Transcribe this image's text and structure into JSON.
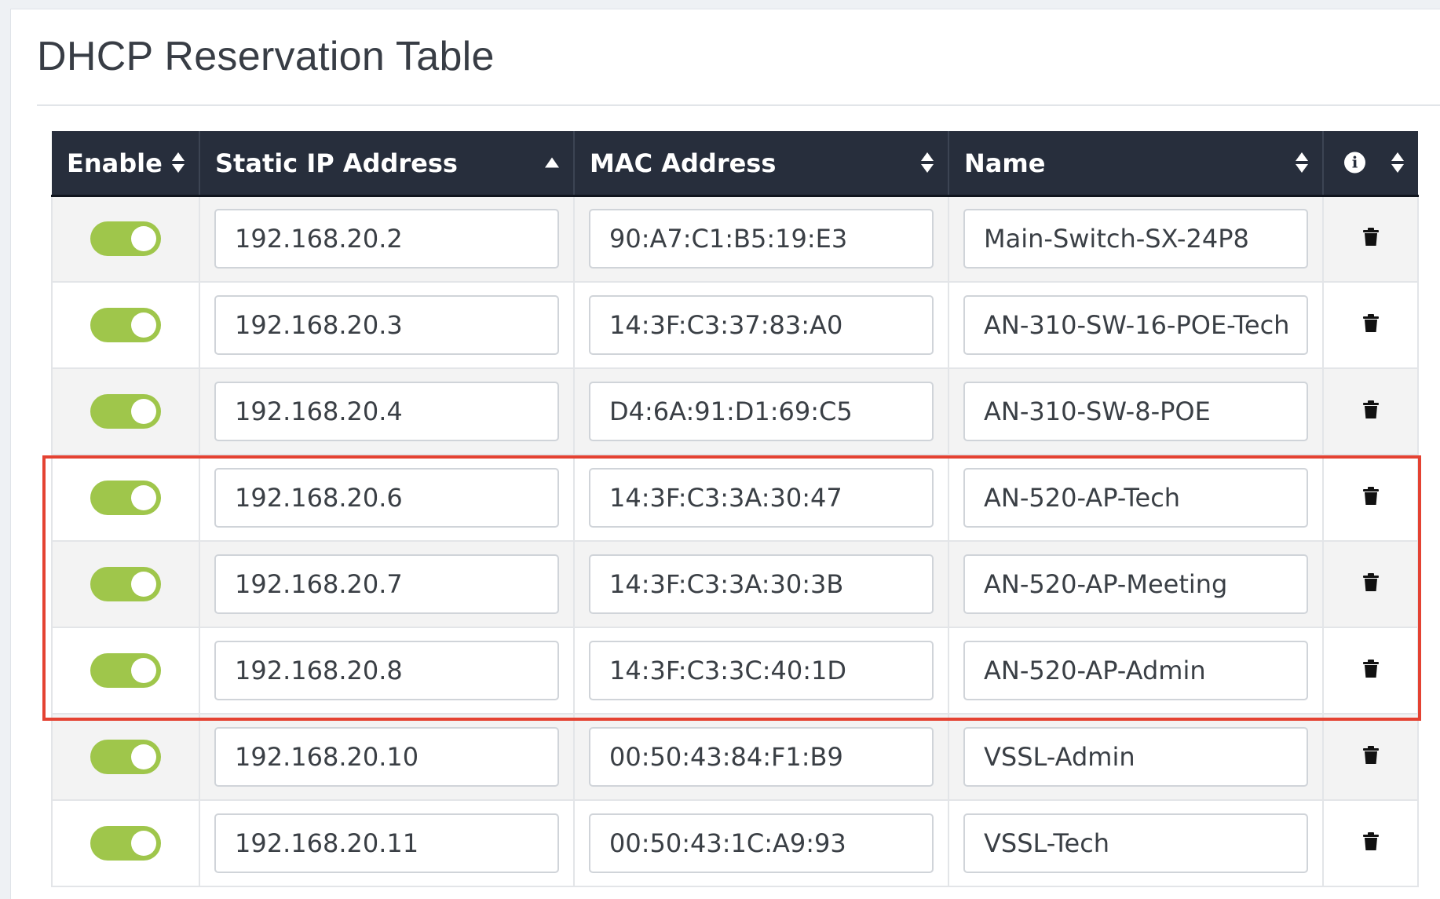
{
  "page": {
    "title": "DHCP Reservation Table"
  },
  "table": {
    "columns": [
      {
        "label": "Enable",
        "sort": "both"
      },
      {
        "label": "Static IP Address",
        "sort": "asc"
      },
      {
        "label": "MAC Address",
        "sort": "both"
      },
      {
        "label": "Name",
        "sort": "both"
      },
      {
        "label": "",
        "icon": "info-icon",
        "sort": "both"
      }
    ],
    "rows": [
      {
        "enabled": true,
        "ip": "192.168.20.2",
        "mac": "90:A7:C1:B5:19:E3",
        "name": "Main-Switch-SX-24P8"
      },
      {
        "enabled": true,
        "ip": "192.168.20.3",
        "mac": "14:3F:C3:37:83:A0",
        "name": "AN-310-SW-16-POE-Tech"
      },
      {
        "enabled": true,
        "ip": "192.168.20.4",
        "mac": "D4:6A:91:D1:69:C5",
        "name": "AN-310-SW-8-POE"
      },
      {
        "enabled": true,
        "ip": "192.168.20.6",
        "mac": "14:3F:C3:3A:30:47",
        "name": "AN-520-AP-Tech"
      },
      {
        "enabled": true,
        "ip": "192.168.20.7",
        "mac": "14:3F:C3:3A:30:3B",
        "name": "AN-520-AP-Meeting"
      },
      {
        "enabled": true,
        "ip": "192.168.20.8",
        "mac": "14:3F:C3:3C:40:1D",
        "name": "AN-520-AP-Admin"
      },
      {
        "enabled": true,
        "ip": "192.168.20.10",
        "mac": "00:50:43:84:F1:B9",
        "name": "VSSL-Admin"
      },
      {
        "enabled": true,
        "ip": "192.168.20.11",
        "mac": "00:50:43:1C:A9:93",
        "name": "VSSL-Tech"
      }
    ]
  },
  "colors": {
    "header_bg": "#272e3c",
    "toggle_on": "#9fc64b",
    "highlight": "#e44232"
  }
}
